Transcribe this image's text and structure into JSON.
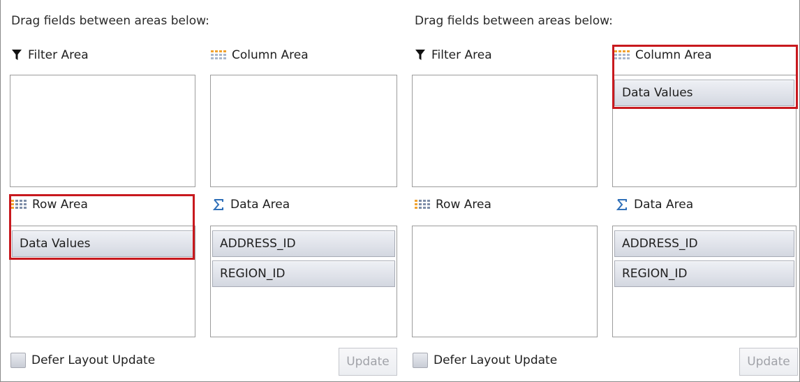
{
  "panels": [
    {
      "instruction": "Drag fields between areas below:",
      "filter_area": {
        "label": "Filter Area",
        "fields": []
      },
      "column_area": {
        "label": "Column Area",
        "fields": []
      },
      "row_area": {
        "label": "Row Area",
        "fields": [
          "Data Values"
        ]
      },
      "data_area": {
        "label": "Data Area",
        "fields": [
          "ADDRESS_ID",
          "REGION_ID"
        ]
      },
      "defer_label": "Defer Layout Update",
      "update_label": "Update"
    },
    {
      "instruction": "Drag fields between areas below:",
      "filter_area": {
        "label": "Filter Area",
        "fields": []
      },
      "column_area": {
        "label": "Column Area",
        "fields": [
          "Data Values"
        ]
      },
      "row_area": {
        "label": "Row Area",
        "fields": []
      },
      "data_area": {
        "label": "Data Area",
        "fields": [
          "ADDRESS_ID",
          "REGION_ID"
        ]
      },
      "defer_label": "Defer Layout Update",
      "update_label": "Update"
    }
  ],
  "icons": {
    "filter": "funnel-icon",
    "column": "column-grid-icon",
    "row": "row-grid-icon",
    "data": "sigma-icon"
  },
  "colors": {
    "highlight": "#c8191e",
    "accent_orange": "#f0a230",
    "sigma_blue": "#2f6fb8"
  }
}
